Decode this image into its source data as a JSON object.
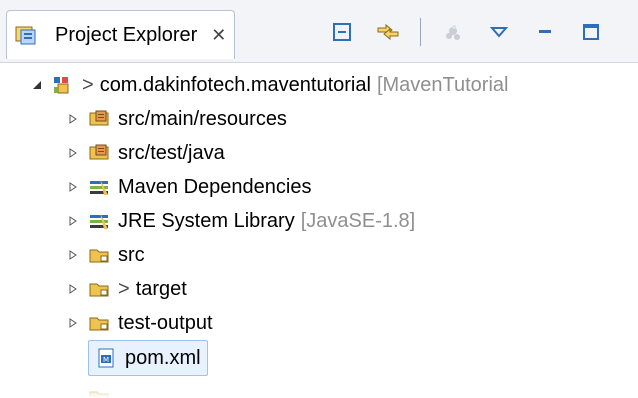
{
  "app": {
    "view_title": "Project Explorer",
    "close_glyph": "✕"
  },
  "toolbar": {
    "icons": [
      "collapse-all-icon",
      "link-with-editor-icon",
      "focus-on-active-task-icon",
      "view-menu-icon",
      "minimize-icon",
      "maximize-icon"
    ]
  },
  "tree": {
    "items": [
      {
        "name": "project-root",
        "has_decor_prefix": true,
        "prefix": ">",
        "label": "com.dakinfotech.maventutorial",
        "decoration": "[MavenTutorial",
        "expanded": true
      },
      {
        "name": "src-main-resources",
        "label": "src/main/resources"
      },
      {
        "name": "src-test-java",
        "label": "src/test/java"
      },
      {
        "name": "maven-dependencies",
        "label": "Maven Dependencies"
      },
      {
        "name": "jre-system-library",
        "label": "JRE System Library",
        "decoration": "[JavaSE-1.8]"
      },
      {
        "name": "src-folder",
        "label": "src"
      },
      {
        "name": "target-folder",
        "prefix": ">",
        "label": "target"
      },
      {
        "name": "test-output-folder",
        "label": "test-output"
      },
      {
        "name": "pom-xml",
        "label": "pom.xml"
      }
    ]
  },
  "colors": {
    "accent": "#4f86d9",
    "folder": "#f0c24f",
    "library": "#2f6fb8"
  }
}
